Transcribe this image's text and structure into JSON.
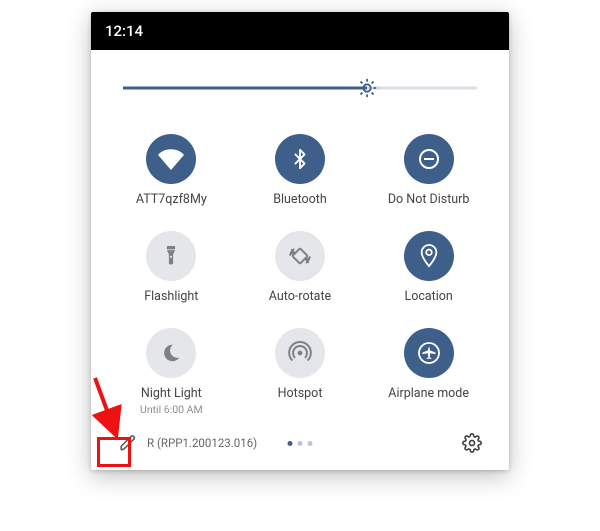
{
  "status": {
    "time": "12:14"
  },
  "brightness": {
    "percent": 69
  },
  "tiles": [
    {
      "label": "ATT7qzf8My",
      "sublabel": "",
      "active": true,
      "icon": "wifi"
    },
    {
      "label": "Bluetooth",
      "sublabel": "",
      "active": true,
      "icon": "bluetooth"
    },
    {
      "label": "Do Not Disturb",
      "sublabel": "",
      "active": true,
      "icon": "dnd"
    },
    {
      "label": "Flashlight",
      "sublabel": "",
      "active": false,
      "icon": "flashlight"
    },
    {
      "label": "Auto-rotate",
      "sublabel": "",
      "active": false,
      "icon": "rotate"
    },
    {
      "label": "Location",
      "sublabel": "",
      "active": true,
      "icon": "location"
    },
    {
      "label": "Night Light",
      "sublabel": "Until 6:00 AM",
      "active": false,
      "icon": "nightlight"
    },
    {
      "label": "Hotspot",
      "sublabel": "",
      "active": false,
      "icon": "hotspot"
    },
    {
      "label": "Airplane mode",
      "sublabel": "",
      "active": true,
      "icon": "airplane"
    }
  ],
  "footer": {
    "build": "R (RPP1.200123.016)",
    "page_count": 3,
    "active_page": 0
  },
  "annotation": {
    "target": "edit-button",
    "color": "#e11"
  }
}
